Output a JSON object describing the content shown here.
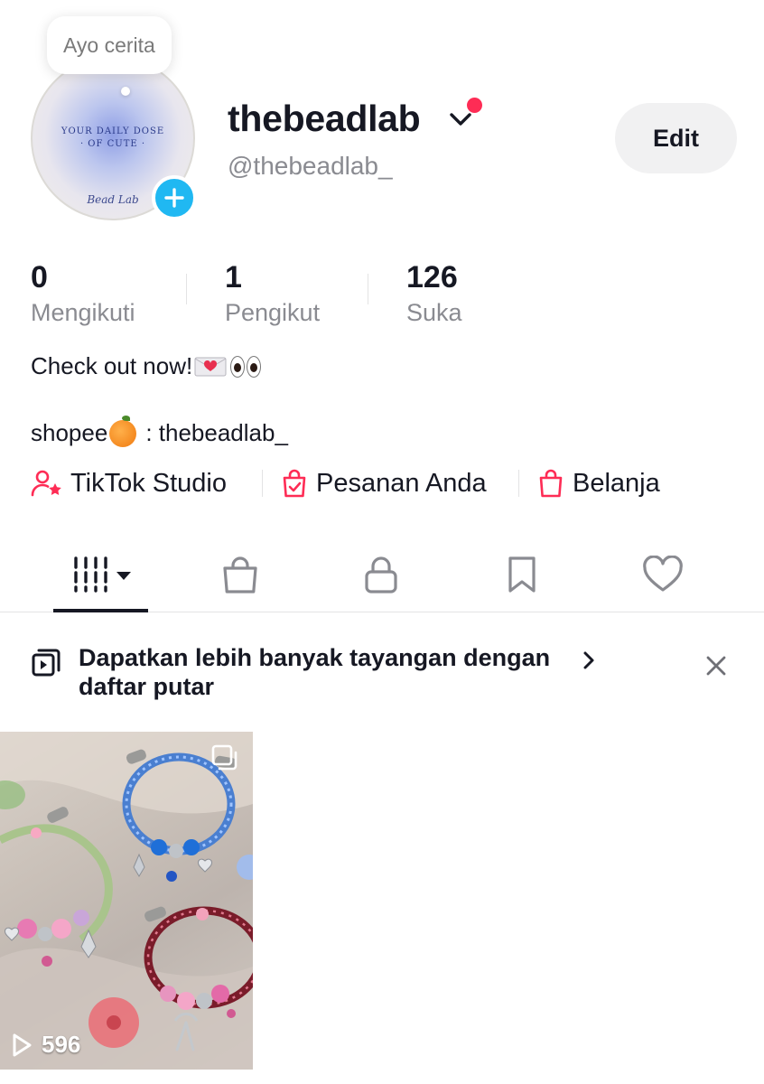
{
  "profile": {
    "story_bubble": "Ayo cerita",
    "avatar_text_line1": "YOUR DAILY DOSE",
    "avatar_text_line2": "· OF CUTE ·",
    "avatar_signature": "Bead Lab",
    "display_name": "thebeadlab",
    "username": "@thebeadlab_",
    "edit_label": "Edit",
    "accent_color": "#fe2c55",
    "add_story_color": "#20b8f2"
  },
  "stats": [
    {
      "value": "0",
      "label": "Mengikuti"
    },
    {
      "value": "1",
      "label": "Pengikut"
    },
    {
      "value": "126",
      "label": "Suka"
    }
  ],
  "bio": {
    "line1": "Check out now!",
    "line2_prefix": "shopee",
    "line2_suffix": ": thebeadlab_"
  },
  "links": [
    {
      "label": "TikTok Studio",
      "icon": "creator-star-icon"
    },
    {
      "label": "Pesanan Anda",
      "icon": "orders-bag-icon"
    },
    {
      "label": "Belanja",
      "icon": "shop-bag-icon"
    }
  ],
  "tabs": [
    {
      "name": "videos",
      "icon": "grid-icon",
      "selected": true
    },
    {
      "name": "shop",
      "icon": "shopping-bag-icon",
      "selected": false
    },
    {
      "name": "private",
      "icon": "lock-icon",
      "selected": false
    },
    {
      "name": "favorites",
      "icon": "bookmark-icon",
      "selected": false
    },
    {
      "name": "liked",
      "icon": "heart-icon",
      "selected": false
    }
  ],
  "banner": {
    "text": "Dapatkan lebih banyak tayangan dengan daftar putar"
  },
  "videos": [
    {
      "views": "596"
    }
  ]
}
